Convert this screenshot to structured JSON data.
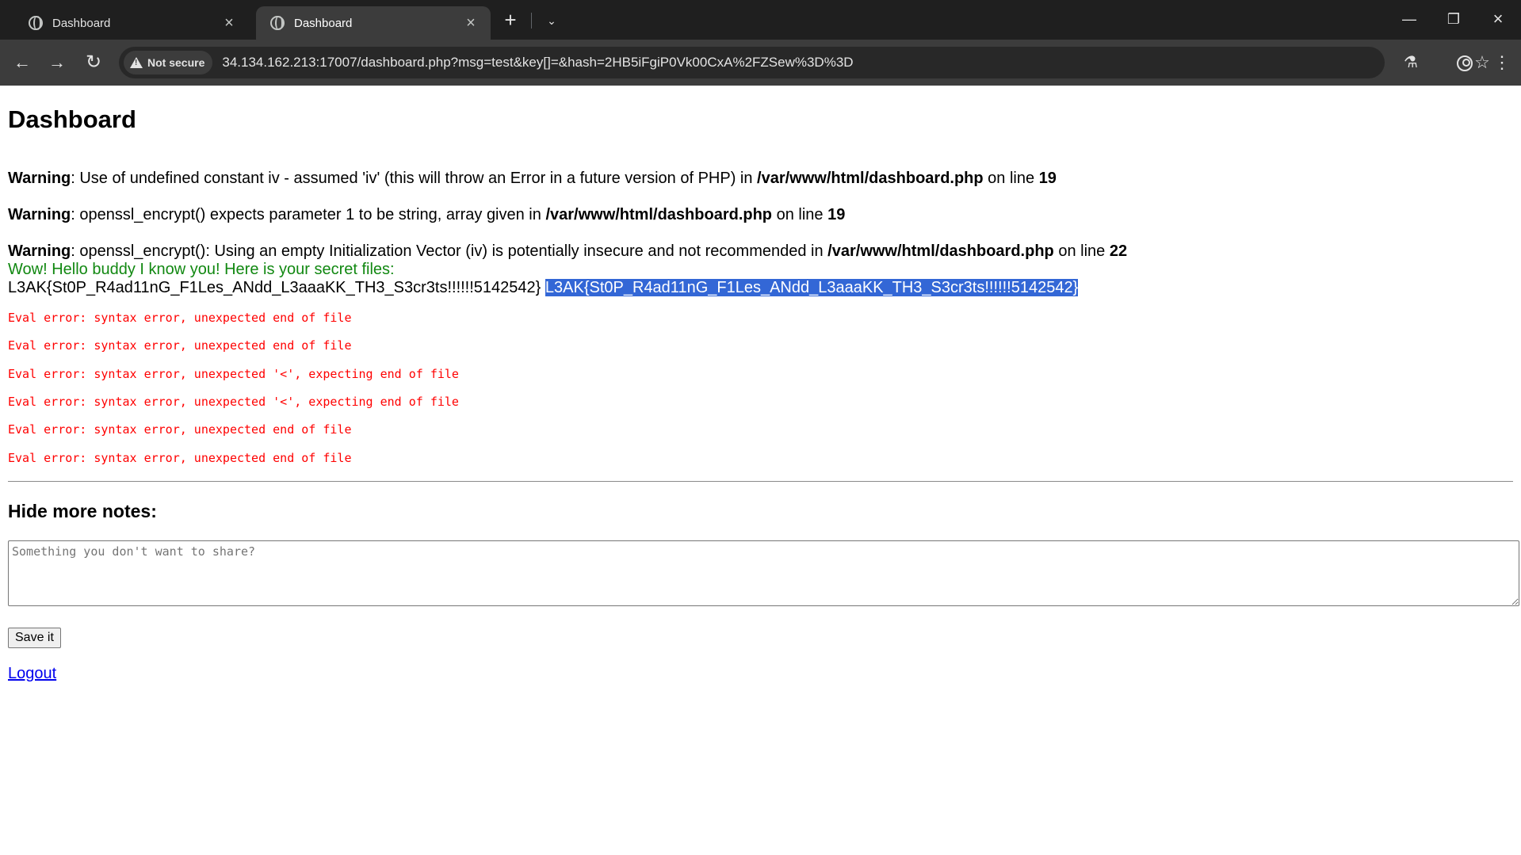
{
  "browser": {
    "tabs": [
      {
        "title": "Dashboard",
        "active": false
      },
      {
        "title": "Dashboard",
        "active": true
      }
    ],
    "security_label": "Not secure",
    "url": "34.134.162.213:17007/dashboard.php?msg=test&key[]=&hash=2HB5iFgiP0Vk00CxA%2FZSew%3D%3D"
  },
  "page": {
    "heading": "Dashboard",
    "warnings": [
      {
        "label": "Warning",
        "message": ": Use of undefined constant iv - assumed 'iv' (this will throw an Error in a future version of PHP) in ",
        "file": "/var/www/html/dashboard.php",
        "on_line": " on line ",
        "line": "19"
      },
      {
        "label": "Warning",
        "message": ": openssl_encrypt() expects parameter 1 to be string, array given in ",
        "file": "/var/www/html/dashboard.php",
        "on_line": " on line ",
        "line": "19"
      },
      {
        "label": "Warning",
        "message": ": openssl_encrypt(): Using an empty Initialization Vector (iv) is potentially insecure and not recommended in ",
        "file": "/var/www/html/dashboard.php",
        "on_line": " on line ",
        "line": "22"
      }
    ],
    "greeting": "Wow! Hello buddy I know you! Here is your secret files:",
    "secret_plain": "L3AK{St0P_R4ad11nG_F1Les_ANdd_L3aaaKK_TH3_S3cr3ts!!!!!!5142542}",
    "secret_selected": "L3AK{St0P_R4ad11nG_F1Les_ANdd_L3aaaKK_TH3_S3cr3ts!!!!!!5142542}",
    "eval_errors": [
      "Eval error: syntax error, unexpected end of file",
      "Eval error: syntax error, unexpected end of file",
      "Eval error: syntax error, unexpected '<', expecting end of file",
      "Eval error: syntax error, unexpected '<', expecting end of file",
      "Eval error: syntax error, unexpected end of file",
      "Eval error: syntax error, unexpected end of file"
    ],
    "notes_heading": "Hide more notes:",
    "notes_placeholder": "Something you don't want to share?",
    "notes_value": "",
    "save_label": "Save it",
    "logout_label": "Logout"
  },
  "colors": {
    "greeting": "#118811",
    "eval_error": "#ff0000",
    "selection": "#3367d6",
    "link": "#0000ee"
  }
}
